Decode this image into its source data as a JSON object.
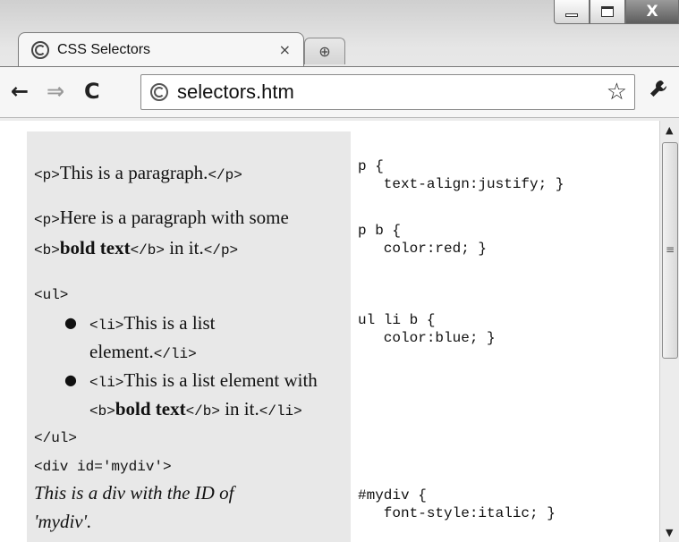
{
  "window": {
    "minimize_glyph": "",
    "close_glyph": "X"
  },
  "tab": {
    "title": "CSS Selectors",
    "close_glyph": "×",
    "new_tab_glyph": "⊕"
  },
  "toolbar": {
    "back_glyph": "←",
    "forward_glyph": "⇒",
    "reload_glyph": "C",
    "url": "selectors.htm",
    "star_glyph": "☆",
    "wrench_glyph": "🔧"
  },
  "html_panel": {
    "p1": "<p>This is a paragraph.</p>",
    "p2_line1": "<p>Here is a paragraph with some",
    "p2_b_open": "<b>",
    "p2_bold": "bold text",
    "p2_b_close": "</b>",
    "p2_tail": " in it.</p>",
    "ul_open": "<ul>",
    "li1_line1": "<li>This is a list",
    "li1_line2": "element.</li>",
    "li2_line1": "<li>This is a list element with",
    "li2_b_open": "<b>",
    "li2_bold": "bold text",
    "li2_b_close": "</b>",
    "li2_tail": " in it.</li>",
    "ul_close": "</ul>",
    "div_open": "<div id='mydiv'>",
    "div_text_line1": "This is a div with the ID of",
    "div_text_line2": "'mydiv'."
  },
  "css_panel": {
    "rule1_selector": "p {",
    "rule1_decl": "   text-align:justify; }",
    "rule2_selector": "p b {",
    "rule2_decl": "   color:red; }",
    "rule3_selector": "ul li b {",
    "rule3_decl": "   color:blue; }",
    "rule4_selector": "#mydiv {",
    "rule4_decl": "   font-style:italic; }"
  },
  "scrollbar": {
    "up_glyph": "▲",
    "down_glyph": "▼",
    "grip_glyph": "≡"
  }
}
